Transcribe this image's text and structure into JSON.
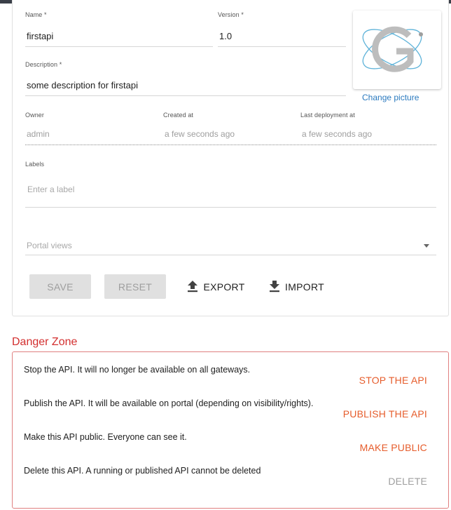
{
  "form": {
    "name_label": "Name *",
    "name_value": "firstapi",
    "version_label": "Version *",
    "version_value": "1.0",
    "description_label": "Description *",
    "description_value": "some description for firstapi",
    "change_picture": "Change picture"
  },
  "meta": {
    "owner_label": "Owner",
    "owner_value": "admin",
    "created_label": "Created at",
    "created_value": "a few seconds ago",
    "deployment_label": "Last deployment at",
    "deployment_value": "a few seconds ago"
  },
  "labels": {
    "label": "Labels",
    "placeholder": "Enter a label"
  },
  "portal_views": {
    "placeholder": "Portal views"
  },
  "actions": {
    "save": "SAVE",
    "reset": "RESET",
    "export": "EXPORT",
    "import": "IMPORT"
  },
  "danger_zone": {
    "title": "Danger Zone",
    "items": [
      {
        "text": "Stop the API. It will no longer be available on all gateways.",
        "action": "STOP THE API"
      },
      {
        "text": "Publish the API. It will be available on portal (depending on visibility/rights).",
        "action": "PUBLISH THE API"
      },
      {
        "text": "Make this API public. Everyone can see it.",
        "action": "MAKE PUBLIC"
      },
      {
        "text": "Delete this API. A running or published API cannot be deleted",
        "action": "DELETE"
      }
    ]
  },
  "colors": {
    "accent_link": "#2b7abf",
    "danger": "#d32f2f",
    "danger_action": "#e65c2b",
    "logo": "#5fb3d9"
  },
  "icons": [
    "upload-icon",
    "download-icon",
    "dropdown-caret-icon",
    "api-logo-icon"
  ]
}
